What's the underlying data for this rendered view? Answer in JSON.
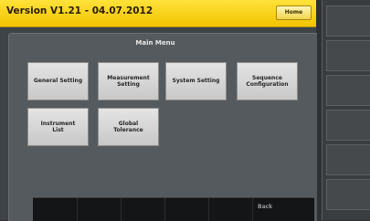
{
  "header": {
    "title": "Version V1.21 - 04.07.2012",
    "home_label": "Home"
  },
  "main_menu": {
    "title": "Main Menu",
    "buttons": [
      {
        "label": "General Setting"
      },
      {
        "label": "Measurement\nSetting"
      },
      {
        "label": "System Setting"
      },
      {
        "label": "Sequence\nConfiguration"
      },
      {
        "label": "Instrument\nList"
      },
      {
        "label": "Global\nTolerance"
      }
    ]
  },
  "footer": {
    "back_label": "Back"
  },
  "colors": {
    "title_bar": "#f3c300",
    "background": "#3e4347",
    "button": "#d6d6d6"
  }
}
